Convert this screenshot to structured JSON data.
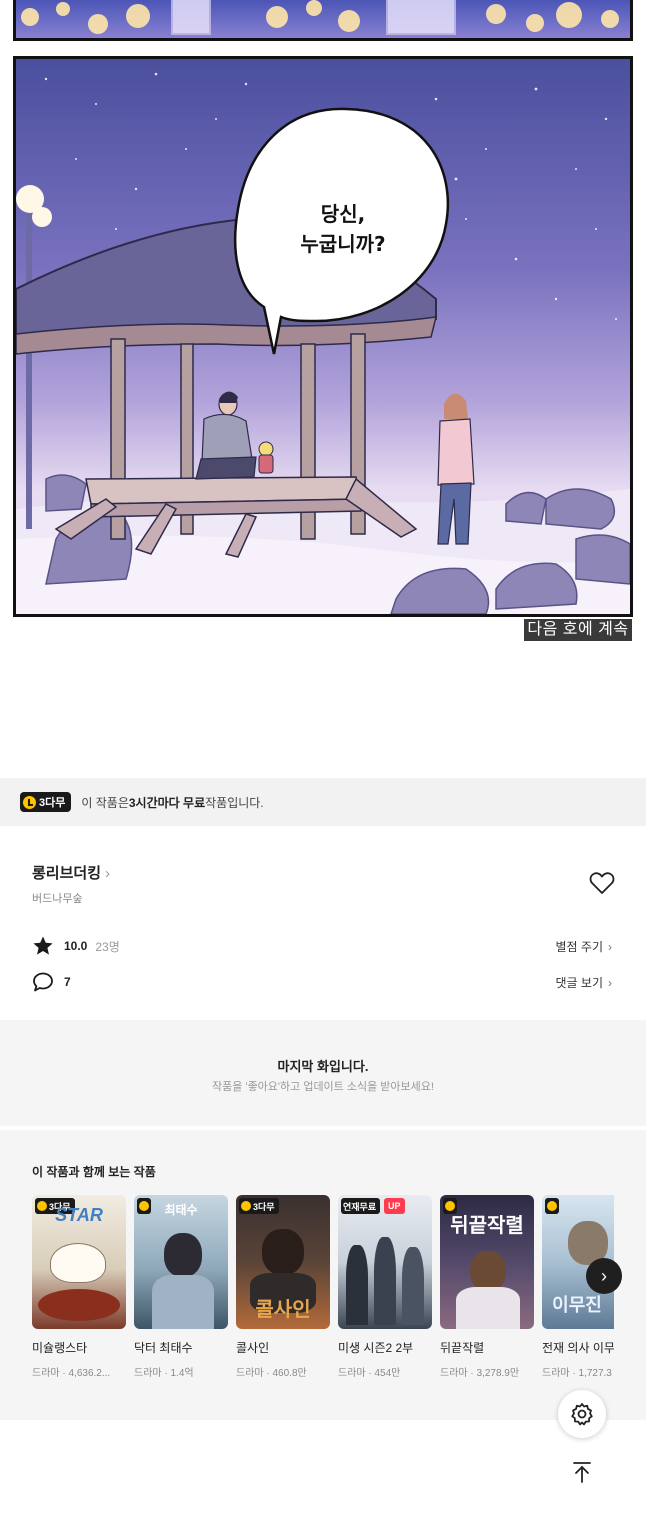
{
  "comic": {
    "speech_bubble_line1": "당신,",
    "speech_bubble_line2": "누굽니까?",
    "caption": "다음 호에 계속"
  },
  "free_notice": {
    "badge": "3다무",
    "text_before": "이 작품은 ",
    "text_bold": "3시간마다 무료",
    "text_after": " 작품입니다."
  },
  "series": {
    "title": "롱리브더킹",
    "title_chevron": "›",
    "author": "버드나무숲",
    "rating": "10.0",
    "rating_count": "23명",
    "rate_label": "별점 주기",
    "comments": "7",
    "comments_label": "댓글 보기",
    "chevron": "›"
  },
  "last_episode": {
    "title": "마지막 화입니다.",
    "subtitle": "작품을 '좋아요'하고 업데이트 소식을 받아보세요!"
  },
  "recommendations": {
    "heading": "이 작품과 함께 보는 작품",
    "items": [
      {
        "name": "미슐랭스타",
        "meta": "드라마 · 4,636.2...",
        "badge": "3다무",
        "cover_text": "STAR",
        "color1": "#e7dcc8",
        "color2": "#7b3a2a"
      },
      {
        "name": "닥터 최태수",
        "meta": "드라마 · 1.4억",
        "badge": "",
        "cover_text": "최태수",
        "color1": "#9fb9c9",
        "color2": "#3d5566"
      },
      {
        "name": "콜사인",
        "meta": "드라마 · 460.8만",
        "badge": "3다무",
        "cover_text": "콜사인",
        "color1": "#4a3a34",
        "color2": "#b36a3b"
      },
      {
        "name": "미생 시즌2 2부",
        "meta": "드라마 · 454만",
        "badge": "연재무료",
        "up": "UP",
        "cover_text": "",
        "color1": "#d9dfe6",
        "color2": "#3b4552"
      },
      {
        "name": "뒤끝작렬",
        "meta": "드라마 · 3,278.9만",
        "badge": "",
        "cover_text": "뒤끝작렬",
        "color1": "#2d2a44",
        "color2": "#8a6a80"
      },
      {
        "name": "전재 의사 이무",
        "meta": "드라마 · 1,727.3",
        "badge": "",
        "cover_text": "이무진",
        "color1": "#b9cfe0",
        "color2": "#5d7a94"
      }
    ]
  },
  "controls": {
    "next_icon": "›",
    "settings_icon": "gear-icon",
    "top_icon": "scroll-top-icon"
  },
  "colors": {
    "accent_yellow": "#ffc400",
    "badge_dark": "#1a1a1a",
    "up_red": "#ff3b4f"
  }
}
